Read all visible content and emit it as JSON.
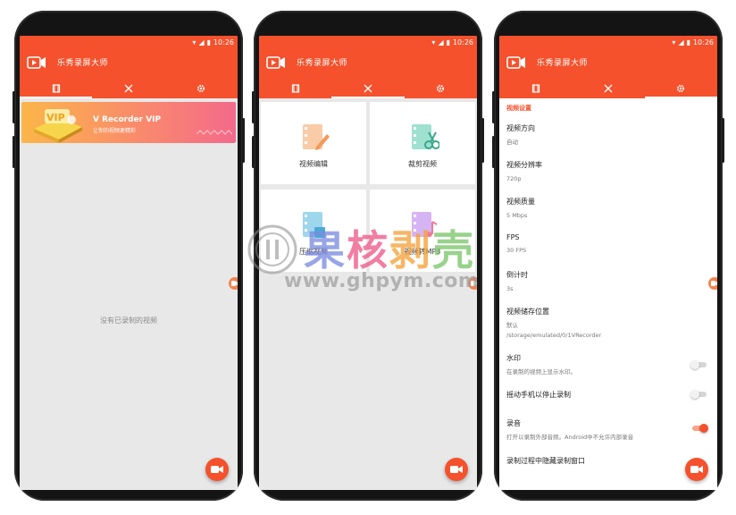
{
  "status_bar": {
    "time": "10:26"
  },
  "app": {
    "title": "乐秀录屏大师",
    "brand_color": "#f4512c"
  },
  "tabs": [
    {
      "icon": "video-list-icon"
    },
    {
      "icon": "tools-icon"
    },
    {
      "icon": "gear-icon"
    }
  ],
  "screen1": {
    "banner": {
      "title": "V Recorder VIP",
      "subtitle": "让你的视频更精彩",
      "badge": "VIP"
    },
    "empty_text": "没有已录制的视频"
  },
  "screen2": {
    "tools": [
      {
        "label": "视频编辑",
        "icon": "video-edit-icon",
        "color": "#f7b98a"
      },
      {
        "label": "裁剪视频",
        "icon": "video-trim-icon",
        "color": "#7fd6c2"
      },
      {
        "label": "压缩视频",
        "icon": "video-compress-icon",
        "color": "#7ec8e8"
      },
      {
        "label": "视频转MP3",
        "icon": "video-to-mp3-icon",
        "color": "#c79bf0"
      }
    ]
  },
  "screen3": {
    "section_header": "视频设置",
    "items": [
      {
        "title": "视频方向",
        "sub": "自动"
      },
      {
        "title": "视频分辨率",
        "sub": "720p"
      },
      {
        "title": "视频质量",
        "sub": "5 Mbps"
      },
      {
        "title": "FPS",
        "sub": "30 FPS"
      },
      {
        "title": "倒计时",
        "sub": "3s"
      },
      {
        "title": "视频储存位置",
        "sub": "默认",
        "sub2": "/storage/emulated/0/1VRecorder"
      },
      {
        "title": "水印",
        "sub": "在录制的视频上显示水印。",
        "toggle": false
      },
      {
        "title": "摇动手机以停止录制",
        "sub": "",
        "toggle": false
      },
      {
        "title": "录音",
        "sub": "打开以录制外部音频。Android中不允许内部录音",
        "toggle": true
      },
      {
        "title": "录制过程中隐藏录制窗口",
        "sub": ""
      }
    ]
  },
  "watermark": {
    "chars": [
      "果",
      "核",
      "剥",
      "壳"
    ],
    "url": "www.ghpym.com"
  }
}
